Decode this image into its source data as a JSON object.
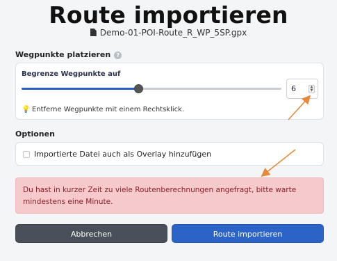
{
  "page": {
    "title": "Route importieren",
    "filename": "Demo-01-POI-Route_R_WP_5SP.gpx"
  },
  "waypoints": {
    "section_label": "Wegpunkte platzieren",
    "help_glyph": "?",
    "limit_label": "Begrenze Wegpunkte auf",
    "slider_fraction": 0.45,
    "count_value": "6",
    "hint": "Entferne Wegpunkte mit einem Rechtsklick."
  },
  "options": {
    "section_label": "Optionen",
    "overlay_checkbox_label": "Importierte Datei auch als Overlay hinzufügen",
    "overlay_checked": false
  },
  "alert": {
    "message": "Du hast in kurzer Zeit zu viele Routenberechnungen angefragt, bitte warte mindestens eine Minute."
  },
  "buttons": {
    "cancel_label": "Abbrechen",
    "import_label": "Route importieren"
  },
  "colors": {
    "primary": "#2c63c6",
    "cancel": "#4a5059",
    "alert_bg": "#f6c9cc",
    "alert_text": "#8a1f28",
    "annotation_arrow": "#e8893a"
  },
  "icons": {
    "file": "file-icon",
    "help": "help-icon",
    "hint": "lightbulb-icon",
    "annotation": "arrow-annotation"
  }
}
